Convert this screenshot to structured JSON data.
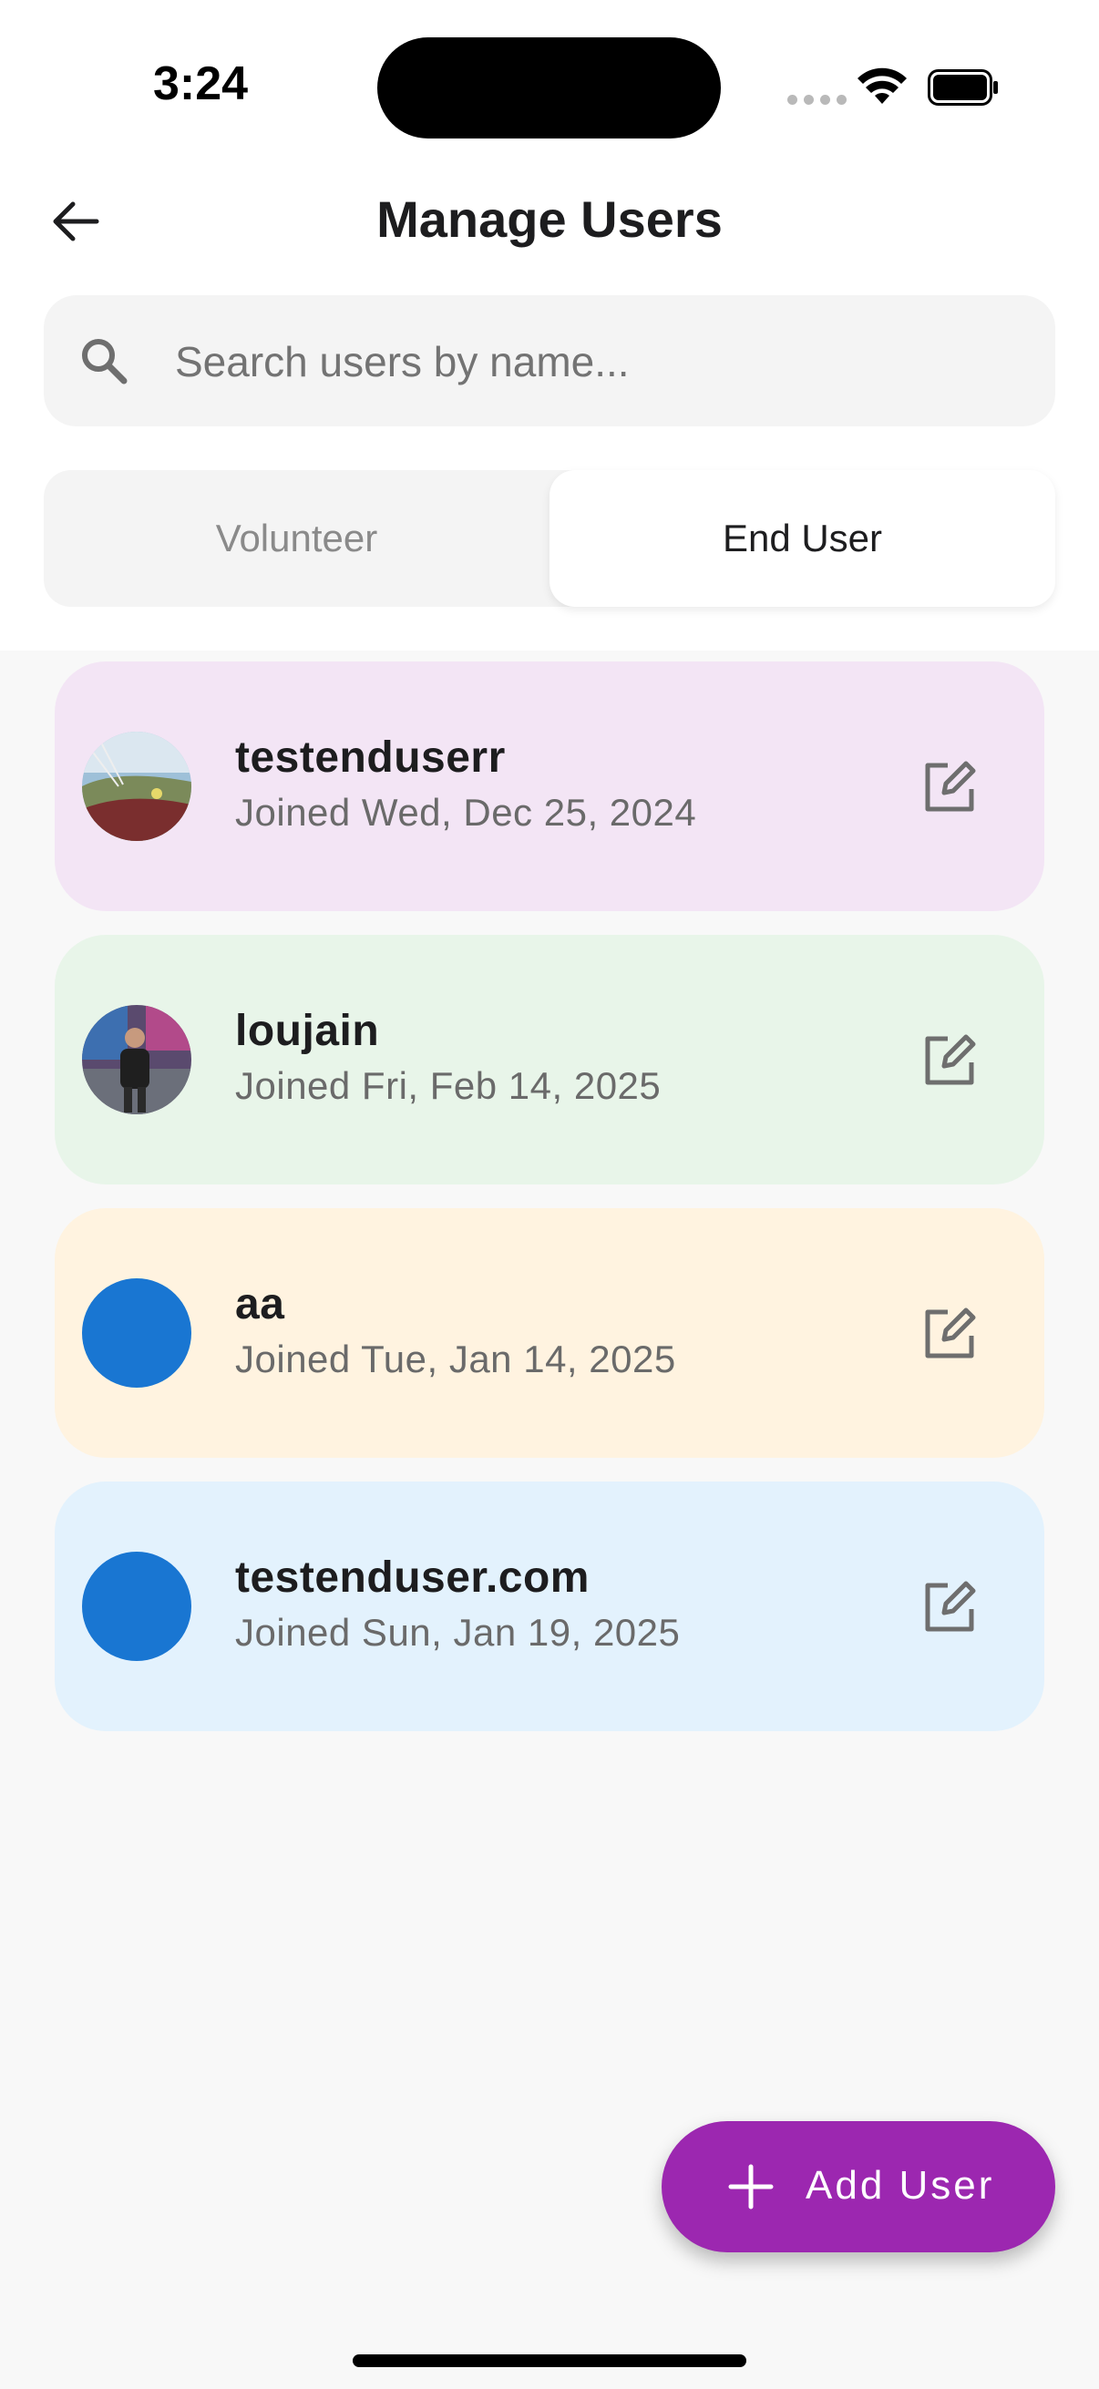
{
  "status_bar": {
    "time": "3:24"
  },
  "header": {
    "title": "Manage Users"
  },
  "search": {
    "placeholder": "Search users by name..."
  },
  "tabs": [
    {
      "label": "Volunteer",
      "selected": false
    },
    {
      "label": "End User",
      "selected": true
    }
  ],
  "users": [
    {
      "name": "testenduserr",
      "joined": "Joined Wed, Dec 25, 2024",
      "bg": "#f3e5f5",
      "avatar": "photo"
    },
    {
      "name": "loujain",
      "joined": "Joined Fri, Feb 14, 2025",
      "bg": "#e8f5e9",
      "avatar": "photo"
    },
    {
      "name": "aa",
      "joined": "Joined Tue, Jan 14, 2025",
      "bg": "#fff3e0",
      "avatar": "default"
    },
    {
      "name": "testenduser.com",
      "joined": "Joined Sun, Jan 19, 2025",
      "bg": "#e3f2fd",
      "avatar": "default"
    }
  ],
  "fab": {
    "label": "Add User",
    "color": "#9c27b0"
  },
  "icons": [
    "back-arrow-icon",
    "search-icon",
    "edit-icon",
    "plus-icon",
    "wifi-icon",
    "battery-icon"
  ]
}
